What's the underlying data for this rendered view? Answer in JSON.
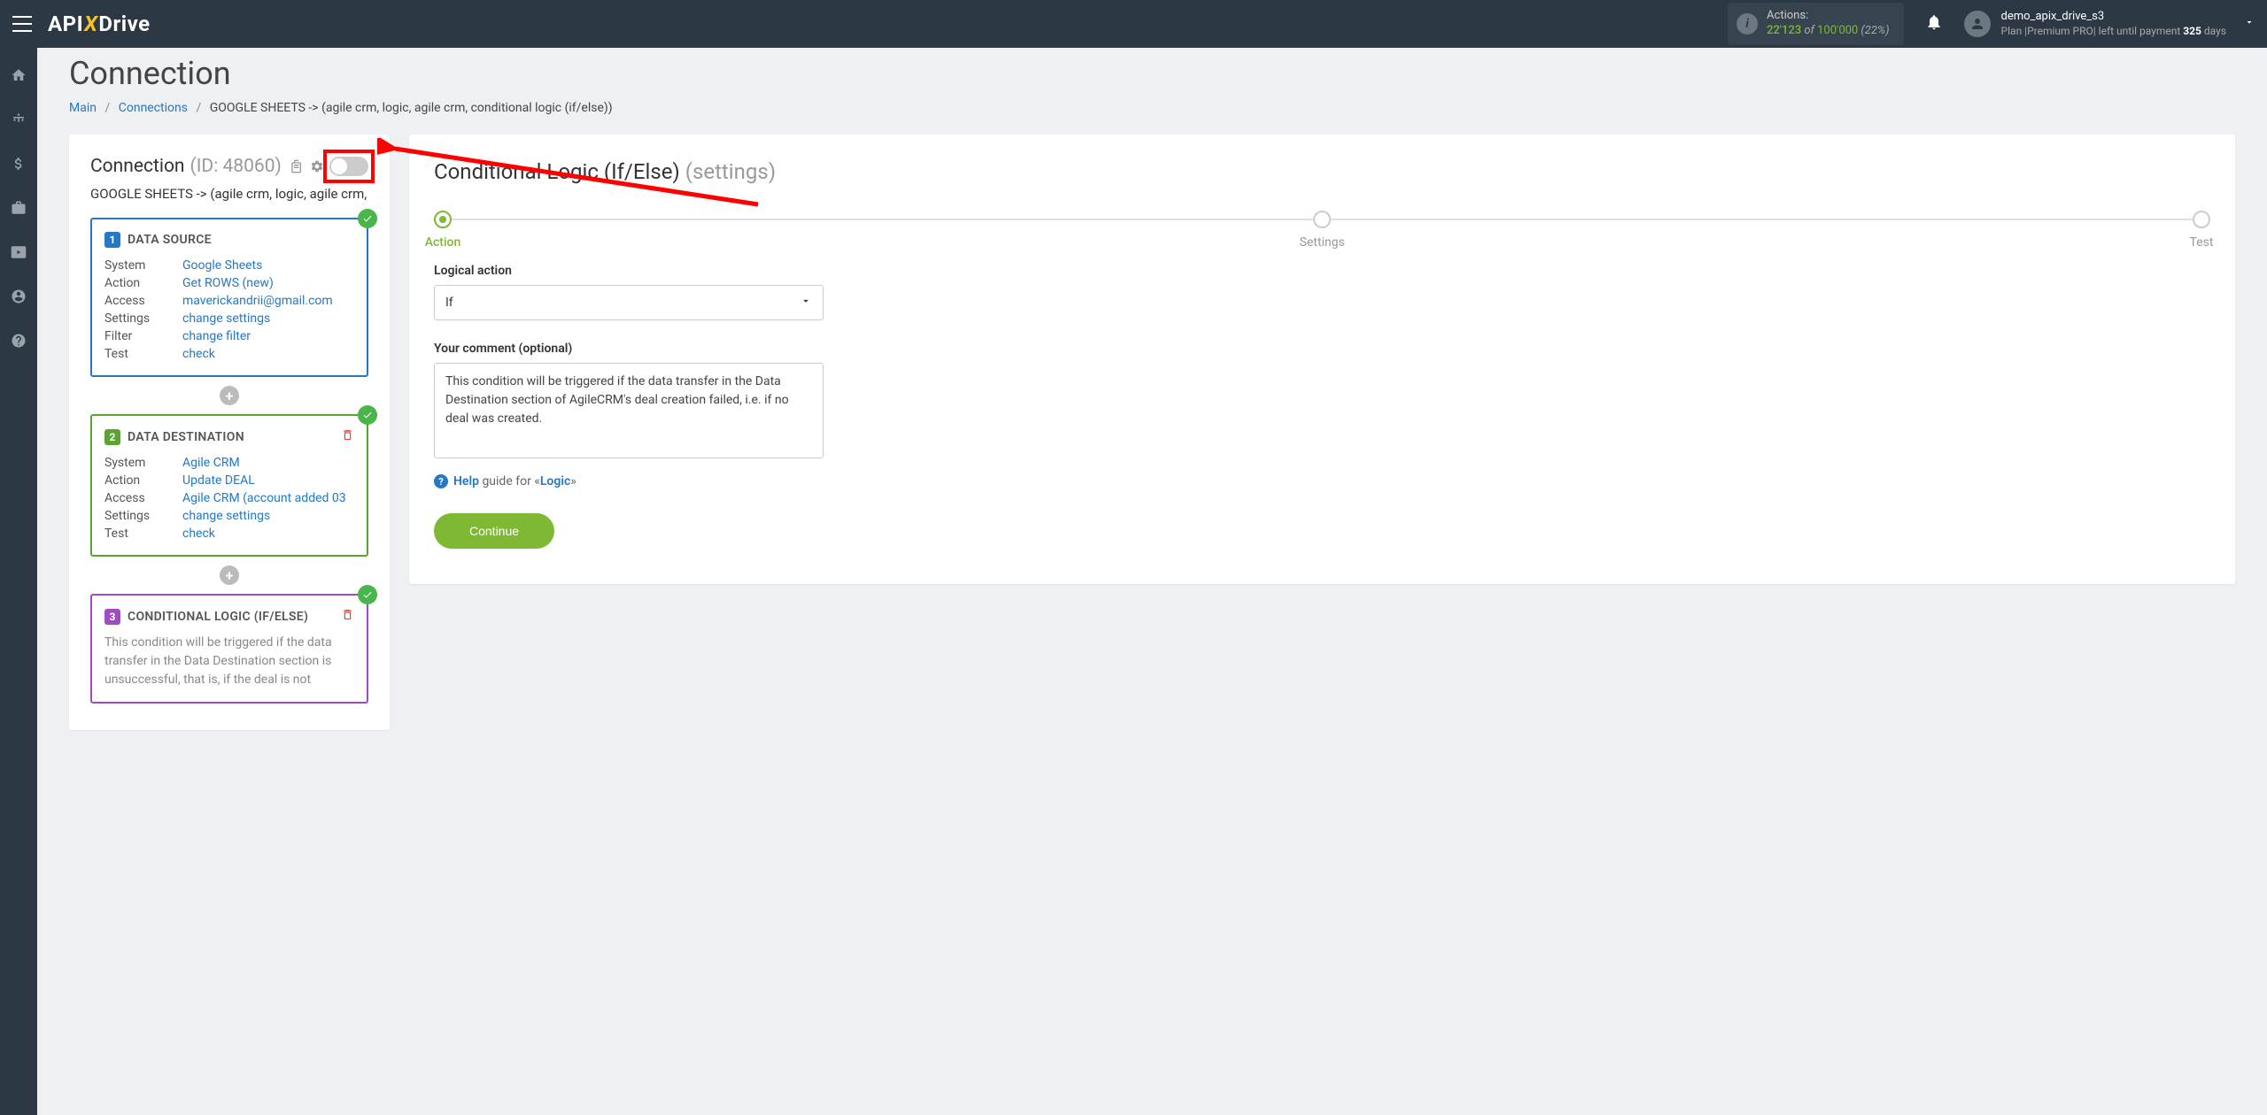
{
  "header": {
    "logo_api": "API",
    "logo_x": "X",
    "logo_drive": "Drive",
    "actions_label": "Actions:",
    "actions_current": "22'123",
    "actions_of": " of ",
    "actions_max": "100'000",
    "actions_pct": " (22%)",
    "user_name": "demo_apix_drive_s3",
    "user_plan_prefix": "Plan |Premium PRO| left until payment ",
    "user_plan_days": "325",
    "user_plan_suffix": " days"
  },
  "page": {
    "title": "Connection",
    "breadcrumb_main": "Main",
    "breadcrumb_connections": "Connections",
    "breadcrumb_current": "GOOGLE SHEETS -> (agile crm, logic, agile crm, conditional logic (if/else))"
  },
  "left_panel": {
    "title": "Connection",
    "id_label": "(ID: 48060)",
    "path": "GOOGLE SHEETS -> (agile crm, logic, agile crm, c",
    "steps": [
      {
        "num": "1",
        "title": "DATA SOURCE",
        "color": "blue",
        "has_trash": false,
        "has_check": true,
        "rows": [
          {
            "label": "System",
            "value": "Google Sheets"
          },
          {
            "label": "Action",
            "value": "Get ROWS (new)"
          },
          {
            "label": "Access",
            "value": "maverickandrii@gmail.com"
          },
          {
            "label": "Settings",
            "value": "change settings"
          },
          {
            "label": "Filter",
            "value": "change filter"
          },
          {
            "label": "Test",
            "value": "check"
          }
        ]
      },
      {
        "num": "2",
        "title": "DATA DESTINATION",
        "color": "green",
        "has_trash": true,
        "has_check": true,
        "rows": [
          {
            "label": "System",
            "value": "Agile CRM"
          },
          {
            "label": "Action",
            "value": "Update DEAL"
          },
          {
            "label": "Access",
            "value": "Agile CRM (account added 03"
          },
          {
            "label": "Settings",
            "value": "change settings"
          },
          {
            "label": "Test",
            "value": "check"
          }
        ]
      },
      {
        "num": "3",
        "title": "CONDITIONAL LOGIC (IF/ELSE)",
        "color": "purple",
        "has_trash": true,
        "has_check": true,
        "desc": "This condition will be triggered if the data transfer in the Data Destination section is unsuccessful, that is, if the deal is not"
      }
    ]
  },
  "right_panel": {
    "title_main": "Conditional Logic (If/Else)",
    "title_sub": "(settings)",
    "stepper": [
      {
        "label": "Action",
        "active": true
      },
      {
        "label": "Settings",
        "active": false
      },
      {
        "label": "Test",
        "active": false
      }
    ],
    "field_logical_label": "Logical action",
    "field_logical_value": "If",
    "field_comment_label": "Your comment (optional)",
    "field_comment_value": "This condition will be triggered if the data transfer in the Data Destination section of AgileCRM's deal creation failed, i.e. if no deal was created.",
    "help_text": "Help",
    "help_guide": " guide for «",
    "help_logic": "Logic",
    "help_end": "»",
    "continue_label": "Continue"
  }
}
